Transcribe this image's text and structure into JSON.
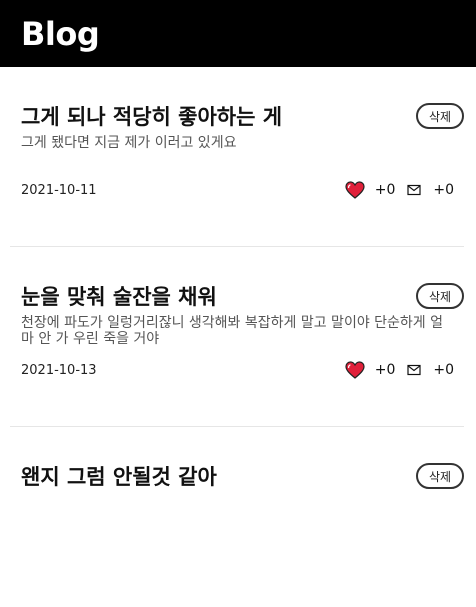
{
  "header": {
    "title": "Blog"
  },
  "posts": [
    {
      "title": "그게 되나 적당히 좋아하는 게",
      "excerpt": "그게 됐다면 지금 제가 이러고 있게요",
      "date": "2021-10-11",
      "delete_label": "삭제",
      "likes": "+0",
      "comments": "+0"
    },
    {
      "title": "눈을 맞춰 술잔을 채워",
      "excerpt": "천장에 파도가 일렁거리잖니 생각해봐 복잡하게 말고 말이야 단순하게 얼마 안 가 우린 죽을 거야",
      "date": "2021-10-13",
      "delete_label": "삭제",
      "likes": "+0",
      "comments": "+0"
    },
    {
      "title": "왠지 그럼 안될것 같아",
      "excerpt": "",
      "date": "",
      "delete_label": "삭제",
      "likes": "",
      "comments": ""
    }
  ],
  "colors": {
    "header_bg": "#000000",
    "heart": "#e0203a"
  },
  "icons": {
    "like": "heart-icon",
    "comment": "mail-icon"
  }
}
